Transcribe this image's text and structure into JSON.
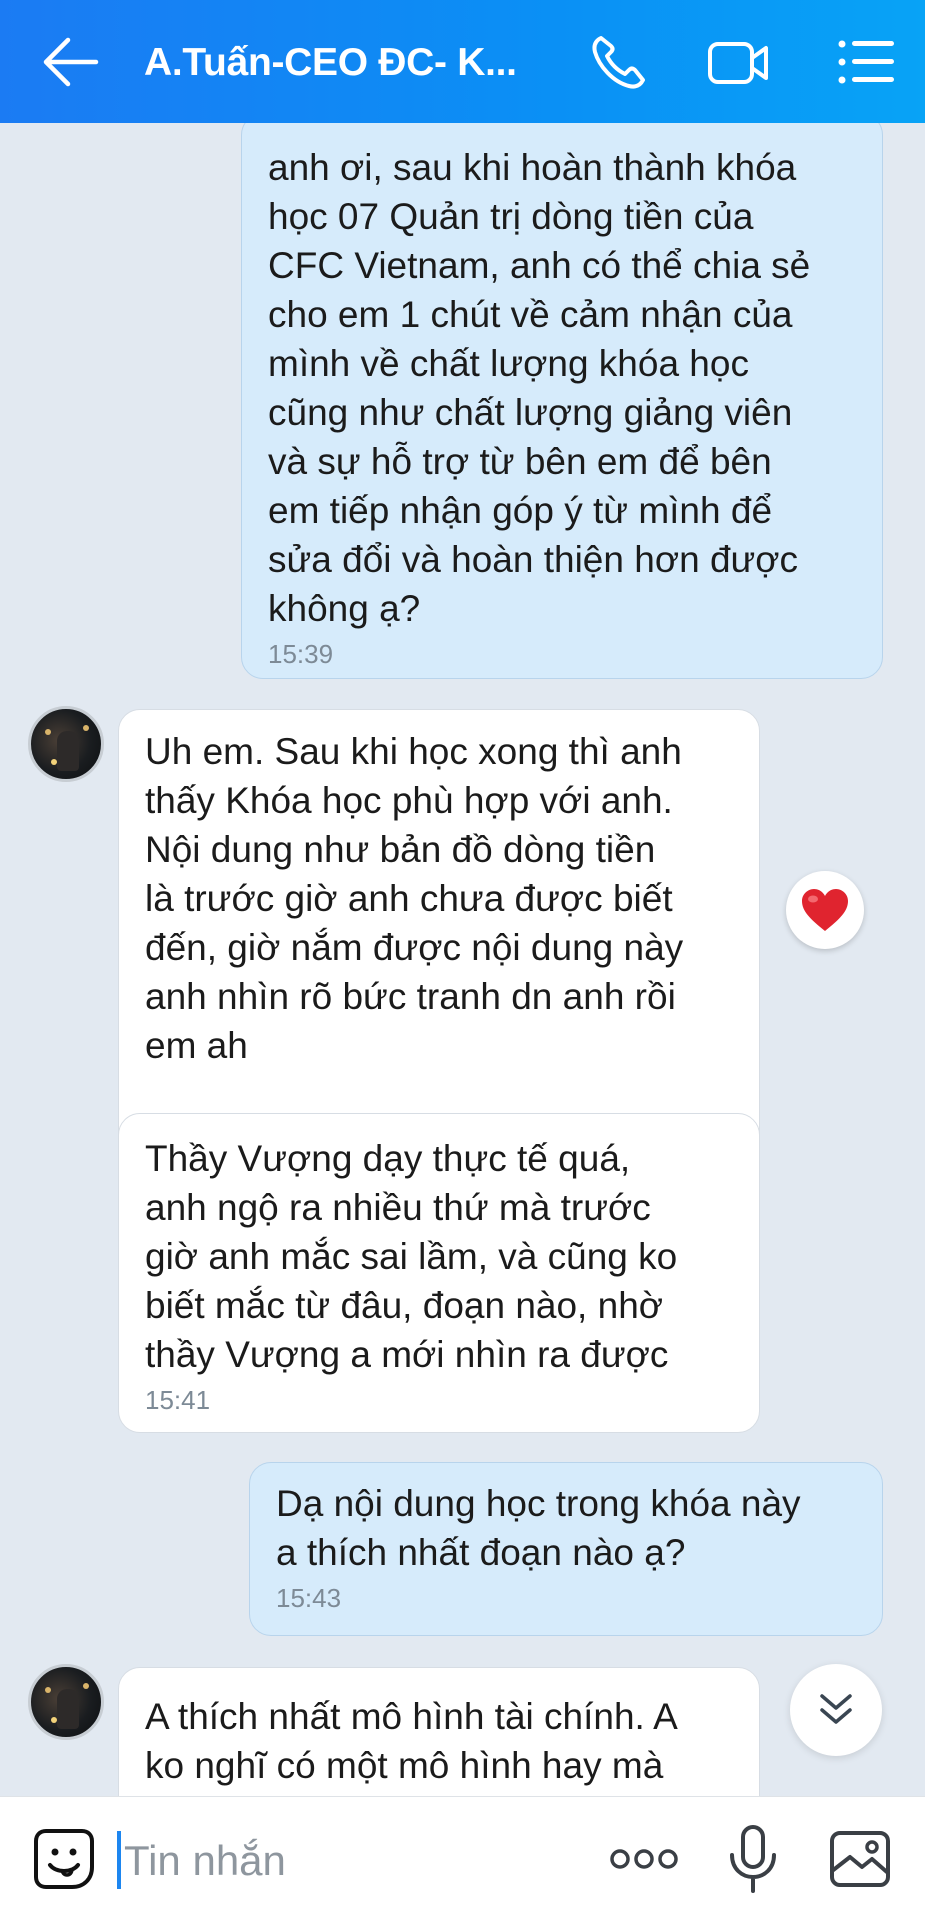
{
  "header": {
    "title": "A.Tuấn-CEO ĐC- K...",
    "icons": [
      "back-arrow-icon",
      "phone-icon",
      "video-call-icon",
      "menu-list-icon"
    ]
  },
  "messages": [
    {
      "direction": "outgoing",
      "text": "anh ơi, sau khi hoàn thành khóa\nhọc 07 Quản trị dòng tiền của\nCFC Vietnam, anh có thể chia sẻ\ncho em 1 chút về cảm nhận của\nmình về chất lượng khóa học\ncũng như chất lượng giảng viên\nvà sự hỗ trợ từ bên em để bên\nem tiếp nhận góp ý từ mình để\nsửa đổi và hoàn thiện hơn được\nkhông ạ?",
      "time": "15:39"
    },
    {
      "direction": "incoming",
      "text": "Uh em. Sau khi học xong thì anh\nthấy Khóa học phù hợp với anh.\nNội dung như bản đồ dòng tiền\nlà trước giờ anh chưa được biết\nđến, giờ nắm được nội dung này\nanh nhìn rõ bức tranh dn anh rồi\nem ah",
      "reaction": "heart"
    },
    {
      "direction": "incoming",
      "text": "Thầy Vượng dạy thực tế quá,\nanh ngộ ra nhiều thứ mà trước\ngiờ anh mắc sai lầm, và cũng ko\nbiết mắc từ đâu, đoạn nào, nhờ\nthầy Vượng a mới nhìn ra được",
      "time": "15:41"
    },
    {
      "direction": "outgoing",
      "text": "Dạ nội dung học trong khóa này\na thích nhất đoạn nào ạ?",
      "time": "15:43"
    },
    {
      "direction": "incoming",
      "text": "A thích nhất mô hình tài chính. A\nko nghĩ có một mô hình hay mà"
    }
  ],
  "input": {
    "placeholder": "Tin nhắn",
    "icons": [
      "sticker-icon",
      "more-options-icon",
      "microphone-icon",
      "image-icon"
    ]
  },
  "colors": {
    "header": "#1b7bf3",
    "background": "#e2e9f1",
    "outgoing_bubble": "#d6ebfb",
    "incoming_bubble": "#ffffff",
    "accent": "#1d86f0",
    "heart": "#e0242f"
  }
}
